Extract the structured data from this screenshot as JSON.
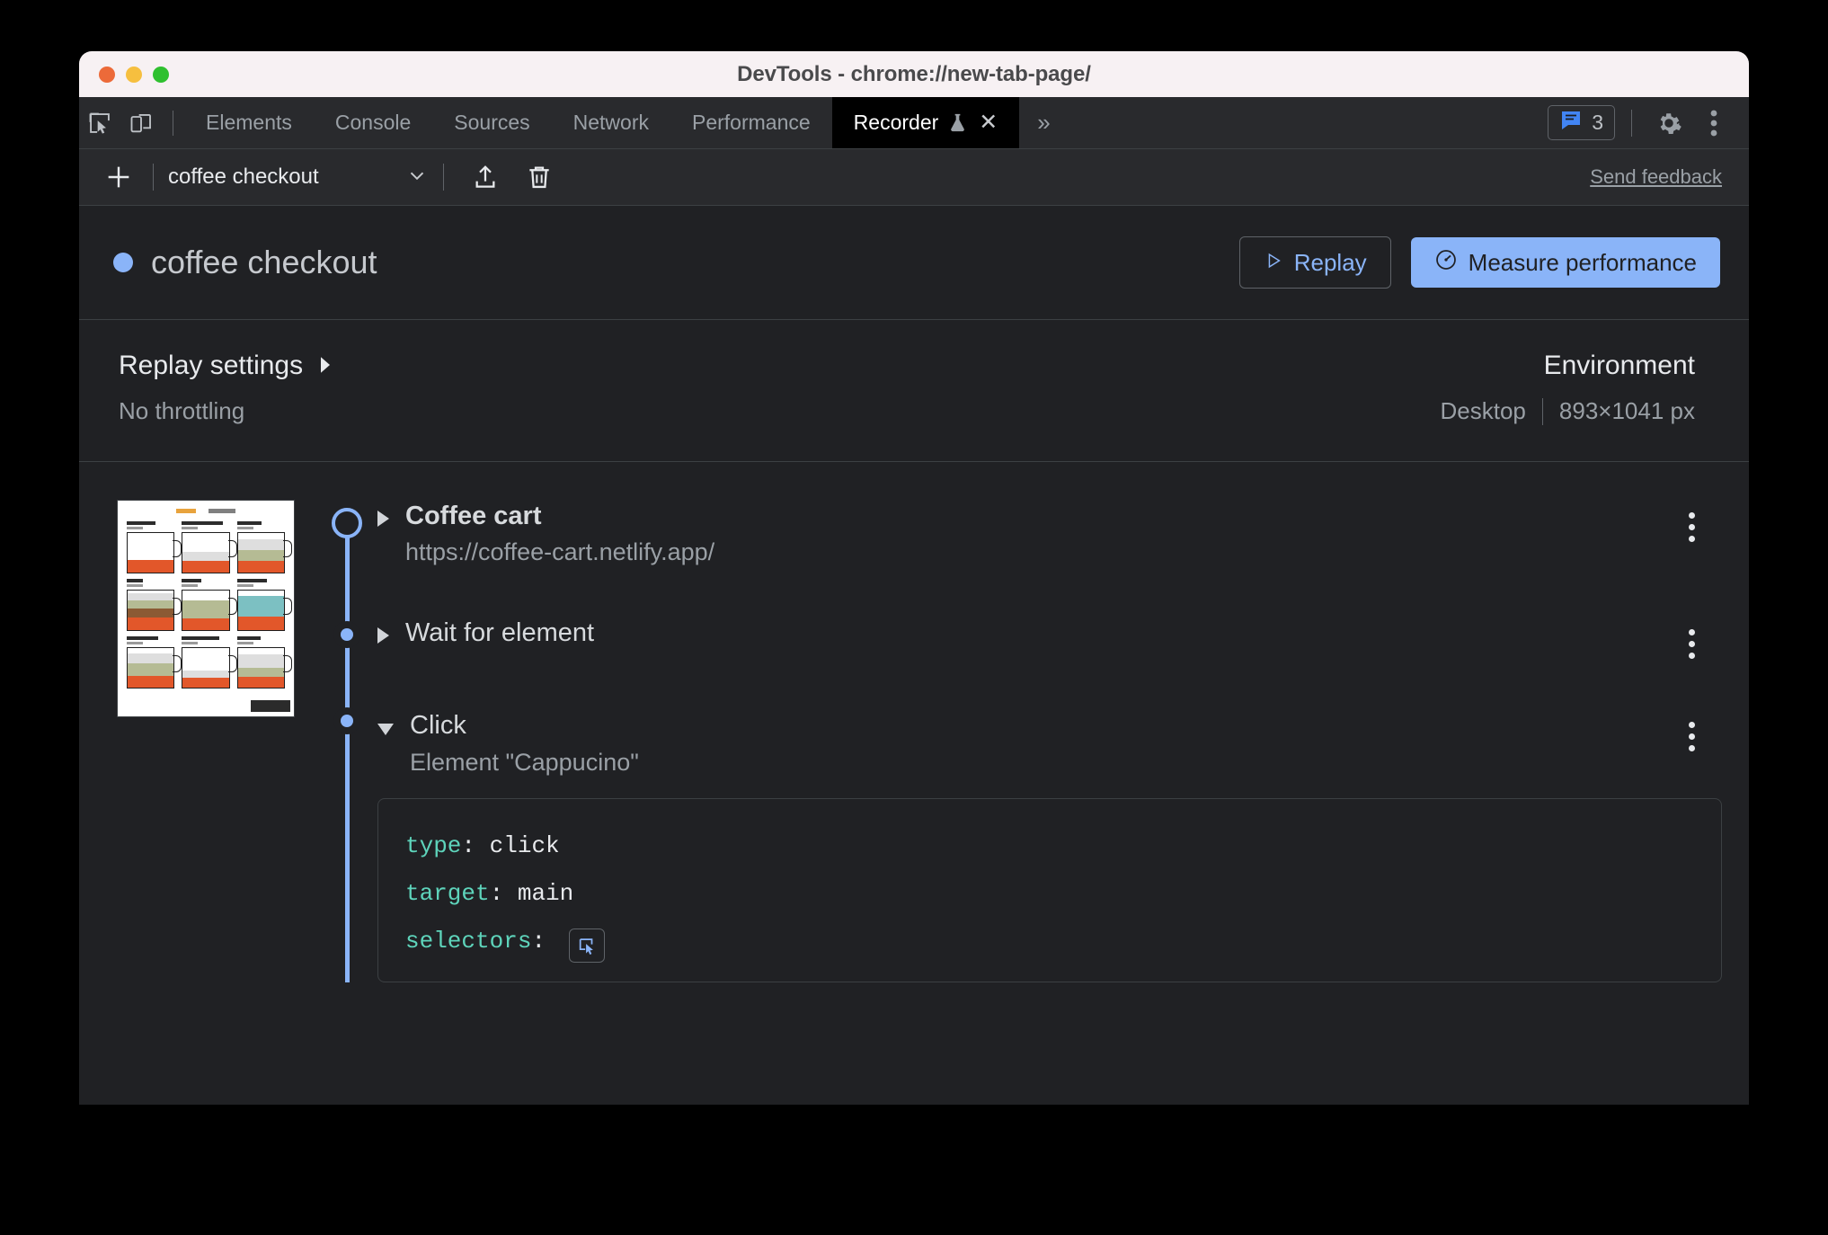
{
  "window": {
    "title": "DevTools - chrome://new-tab-page/",
    "traffic_lights": [
      "close",
      "minimize",
      "zoom"
    ]
  },
  "devtools_tabbar": {
    "left_icons": [
      {
        "name": "inspect-element-icon"
      },
      {
        "name": "device-toolbar-icon"
      }
    ],
    "tabs": [
      {
        "label": "Elements",
        "active": false
      },
      {
        "label": "Console",
        "active": false
      },
      {
        "label": "Sources",
        "active": false
      },
      {
        "label": "Network",
        "active": false
      },
      {
        "label": "Performance",
        "active": false
      },
      {
        "label": "Recorder",
        "active": true,
        "badge_icon": "flask-icon",
        "closable": true
      }
    ],
    "overflow_label": "»",
    "issues_count": "3",
    "right_icons": [
      {
        "name": "issues-icon"
      },
      {
        "name": "settings-gear-icon"
      },
      {
        "name": "more-options-icon"
      }
    ]
  },
  "recorder_toolbar": {
    "add_label": "+",
    "selected_recording": "coffee checkout",
    "dropdown_icon": "chevron-down-icon",
    "export_icon": "export-icon",
    "delete_icon": "trash-icon",
    "feedback_label": "Send feedback"
  },
  "recording": {
    "name": "coffee checkout",
    "status_color": "#8ab4f8",
    "replay_label": "Replay",
    "replay_icon": "play-icon",
    "measure_label": "Measure performance",
    "measure_icon": "speedometer-icon",
    "accent_color": "#8ab4f8"
  },
  "settings": {
    "replay_settings_label": "Replay settings",
    "replay_settings_chevron": "chevron-right-icon",
    "throttling": "No throttling",
    "environment_label": "Environment",
    "device": "Desktop",
    "viewport": "893×1041 px"
  },
  "thumbnail": {
    "name": "coffee-cart-page-screenshot"
  },
  "steps": [
    {
      "name": "Coffee cart",
      "description": "https://coffee-cart.netlify.app/",
      "expanded": false,
      "node": "start",
      "bold": true
    },
    {
      "name": "Wait for element",
      "description": "",
      "expanded": false,
      "node": "dot",
      "bold": false
    },
    {
      "name": "Click",
      "description": "Element \"Cappucino\"",
      "expanded": true,
      "node": "dot",
      "bold": false,
      "code": [
        {
          "key": "type",
          "value": "click"
        },
        {
          "key": "target",
          "value": "main"
        },
        {
          "key": "selectors",
          "value": "",
          "has_picker": true
        }
      ]
    }
  ],
  "icons": {
    "kebab": "more-options-icon",
    "picker": "select-element-icon"
  }
}
